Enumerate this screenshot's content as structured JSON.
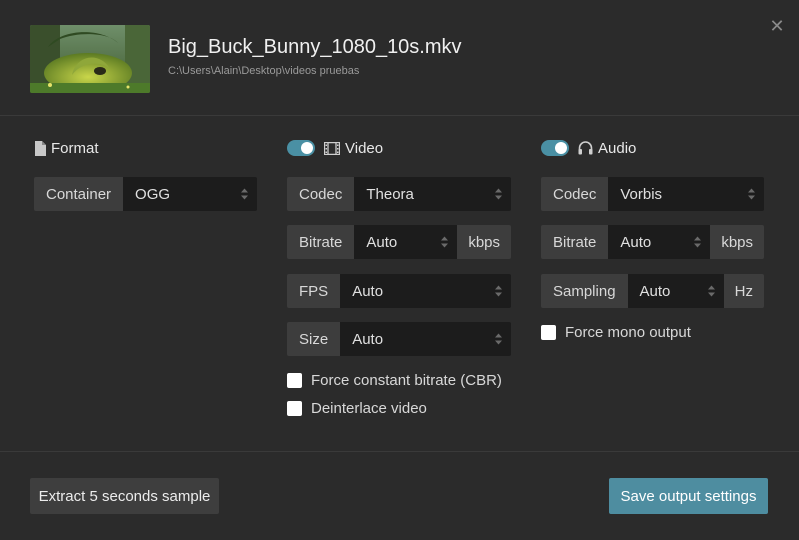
{
  "file": {
    "title": "Big_Buck_Bunny_1080_10s.mkv",
    "path": "C:\\Users\\Alain\\Desktop\\videos pruebas"
  },
  "format": {
    "heading": "Format",
    "heading_icon": "file-icon",
    "container_label": "Container",
    "container_value": "OGG"
  },
  "video": {
    "heading": "Video",
    "heading_icon": "film-icon",
    "enabled": true,
    "codec_label": "Codec",
    "codec_value": "Theora",
    "bitrate_label": "Bitrate",
    "bitrate_value": "Auto",
    "bitrate_unit": "kbps",
    "fps_label": "FPS",
    "fps_value": "Auto",
    "size_label": "Size",
    "size_value": "Auto",
    "cbr_label": "Force constant bitrate (CBR)",
    "deinterlace_label": "Deinterlace video"
  },
  "audio": {
    "heading": "Audio",
    "heading_icon": "headphones-icon",
    "enabled": true,
    "codec_label": "Codec",
    "codec_value": "Vorbis",
    "bitrate_label": "Bitrate",
    "bitrate_value": "Auto",
    "bitrate_unit": "kbps",
    "sampling_label": "Sampling",
    "sampling_value": "Auto",
    "sampling_unit": "Hz",
    "mono_label": "Force mono output"
  },
  "footer": {
    "sample_button": "Extract 5 seconds sample",
    "save_button": "Save output settings"
  },
  "colors": {
    "background": "#2b2b2b",
    "accent": "#4e8da0",
    "field_dark": "#1c1c1c",
    "field_label": "#3d3d3d"
  }
}
